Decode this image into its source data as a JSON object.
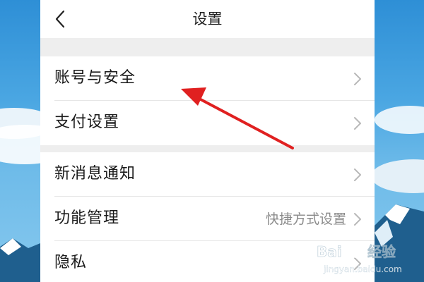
{
  "nav": {
    "title": "设置",
    "back_icon": "chevron-left-icon"
  },
  "groups": [
    {
      "items": [
        {
          "label": "账号与安全",
          "value": ""
        },
        {
          "label": "支付设置",
          "value": ""
        }
      ]
    },
    {
      "items": [
        {
          "label": "新消息通知",
          "value": ""
        },
        {
          "label": "功能管理",
          "value": "快捷方式设置"
        },
        {
          "label": "隐私",
          "value": ""
        }
      ]
    }
  ],
  "annotation": {
    "arrow_color": "#e02020",
    "points_to": "账号与安全"
  },
  "watermark": {
    "brand": "Bai du 经验",
    "url": "jingyan.baidu.com"
  },
  "colors": {
    "page_bg": "#eeeeee",
    "card_bg": "#ffffff",
    "text_primary": "#1a1a1a",
    "text_secondary": "#8a8a8a",
    "chevron": "#b8b8b8"
  }
}
